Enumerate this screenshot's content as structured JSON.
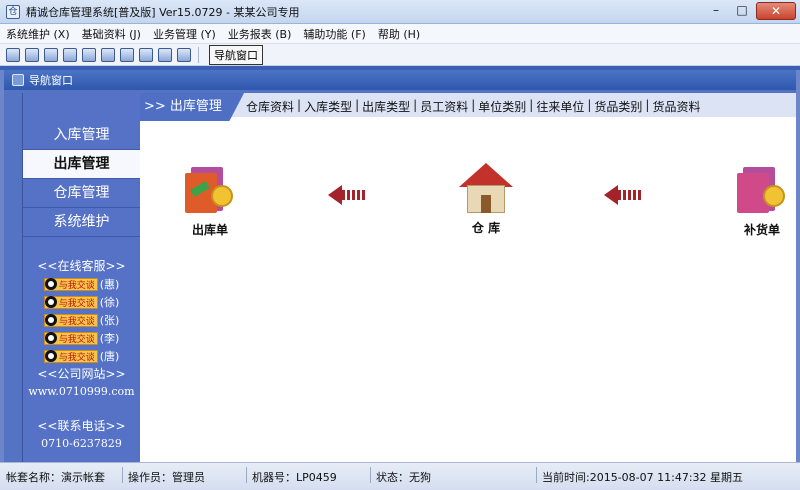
{
  "window": {
    "title": "精诚仓库管理系统[普及版] Ver15.0729 - 某某公司专用",
    "app_icon_glyph": "仓",
    "controls": {
      "minimize": "–",
      "maximize": "□",
      "close": "✕"
    }
  },
  "menu": [
    "系统维护 (X)",
    "基础资料 (J)",
    "业务管理 (Y)",
    "业务报表 (B)",
    "辅助功能 (F)",
    "帮助 (H)"
  ],
  "toolbar": {
    "icons": [
      "window-cascade-icon",
      "window-tile-icon",
      "window-arrange-icon",
      "refresh-icon",
      "edit-icon",
      "monitor-icon",
      "save-icon",
      "print-icon",
      "help-icon",
      "exit-icon"
    ],
    "nav_button_label": "导航窗口"
  },
  "inner_window": {
    "title": "导航窗口"
  },
  "sidebar": {
    "items": [
      "入库管理",
      "出库管理",
      "仓库管理",
      "系统维护"
    ],
    "active_index": 1,
    "support_title": "<<在线客服>>",
    "qq_badge_text": "与我交谈",
    "qq_contacts": [
      "(惠)",
      "(徐)",
      "(张)",
      "(李)",
      "(唐)"
    ],
    "site_title": "<<公司网站>>",
    "site_url": "www.0710999.com",
    "phone_title": "<<联系电话>>",
    "phone": "0710-6237829"
  },
  "content": {
    "section_title": ">> 出库管理",
    "tabs": [
      "仓库资料",
      "入库类型",
      "出库类型",
      "员工资料",
      "单位类别",
      "往来单位",
      "货品类别",
      "货品资料"
    ],
    "tab_separator": "|",
    "flow": {
      "left_label": "出库单",
      "center_label": "仓 库",
      "right_label": "补货单"
    }
  },
  "status": {
    "account": "帐套名称：演示帐套",
    "operator": "操作员：管理员",
    "machine": "机器号：LP0459",
    "state": "状态：无狗",
    "time": "当前时间:2015-08-07 11:47:32 星期五"
  },
  "colors": {
    "sidebar_bg": "#5572c6",
    "header_blue": "#2f57ad",
    "arrow_red": "#a4232a"
  }
}
